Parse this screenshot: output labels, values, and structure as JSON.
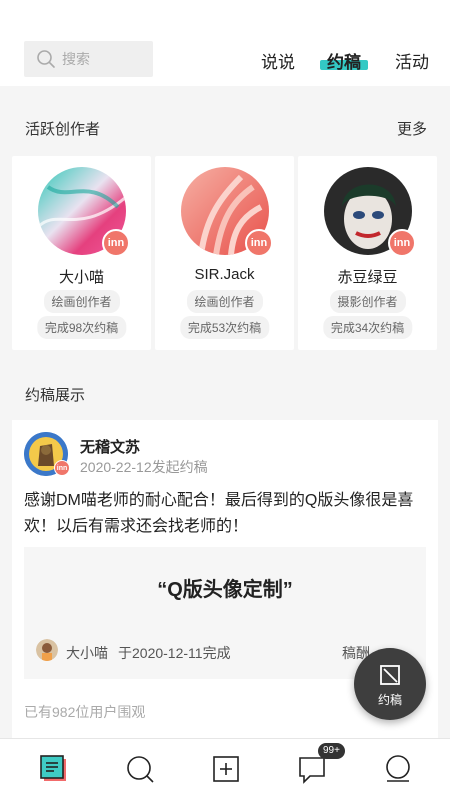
{
  "header": {
    "search_placeholder": "搜索",
    "tabs": [
      {
        "label": "说说"
      },
      {
        "label": "约稿"
      },
      {
        "label": "活动"
      }
    ],
    "active_tab": "约稿",
    "accent_color": "#33c9c4"
  },
  "creators": {
    "title": "活跃创作者",
    "more": "更多",
    "items": [
      {
        "name": "大小喵",
        "role": "绘画创作者",
        "count": "完成98次约稿",
        "badge": "inn"
      },
      {
        "name": "SIR.Jack",
        "role": "绘画创作者",
        "count": "完成53次约稿",
        "badge": "inn"
      },
      {
        "name": "赤豆绿豆",
        "role": "摄影创作者",
        "count": "完成34次约稿",
        "badge": "inn"
      }
    ]
  },
  "showcase": {
    "title": "约稿展示",
    "post": {
      "user": "无稽文苏",
      "badge": "inn",
      "date": "2020-22-12发起约稿",
      "content": "感谢DM喵老师的耐心配合！最后得到的Q版头像很是喜欢！以后有需求还会找老师的！",
      "quote_title": "“Q版头像定制”",
      "artist": "大小喵",
      "completed": "于2020-12-11完成",
      "fee": "稿酬",
      "viewers": "已有982位用户围观"
    }
  },
  "fab": {
    "label": "约稿"
  },
  "bottom_nav": {
    "icons": [
      "notes-icon",
      "search-icon",
      "add-icon",
      "message-icon",
      "profile-icon"
    ],
    "message_badge": "99+"
  }
}
